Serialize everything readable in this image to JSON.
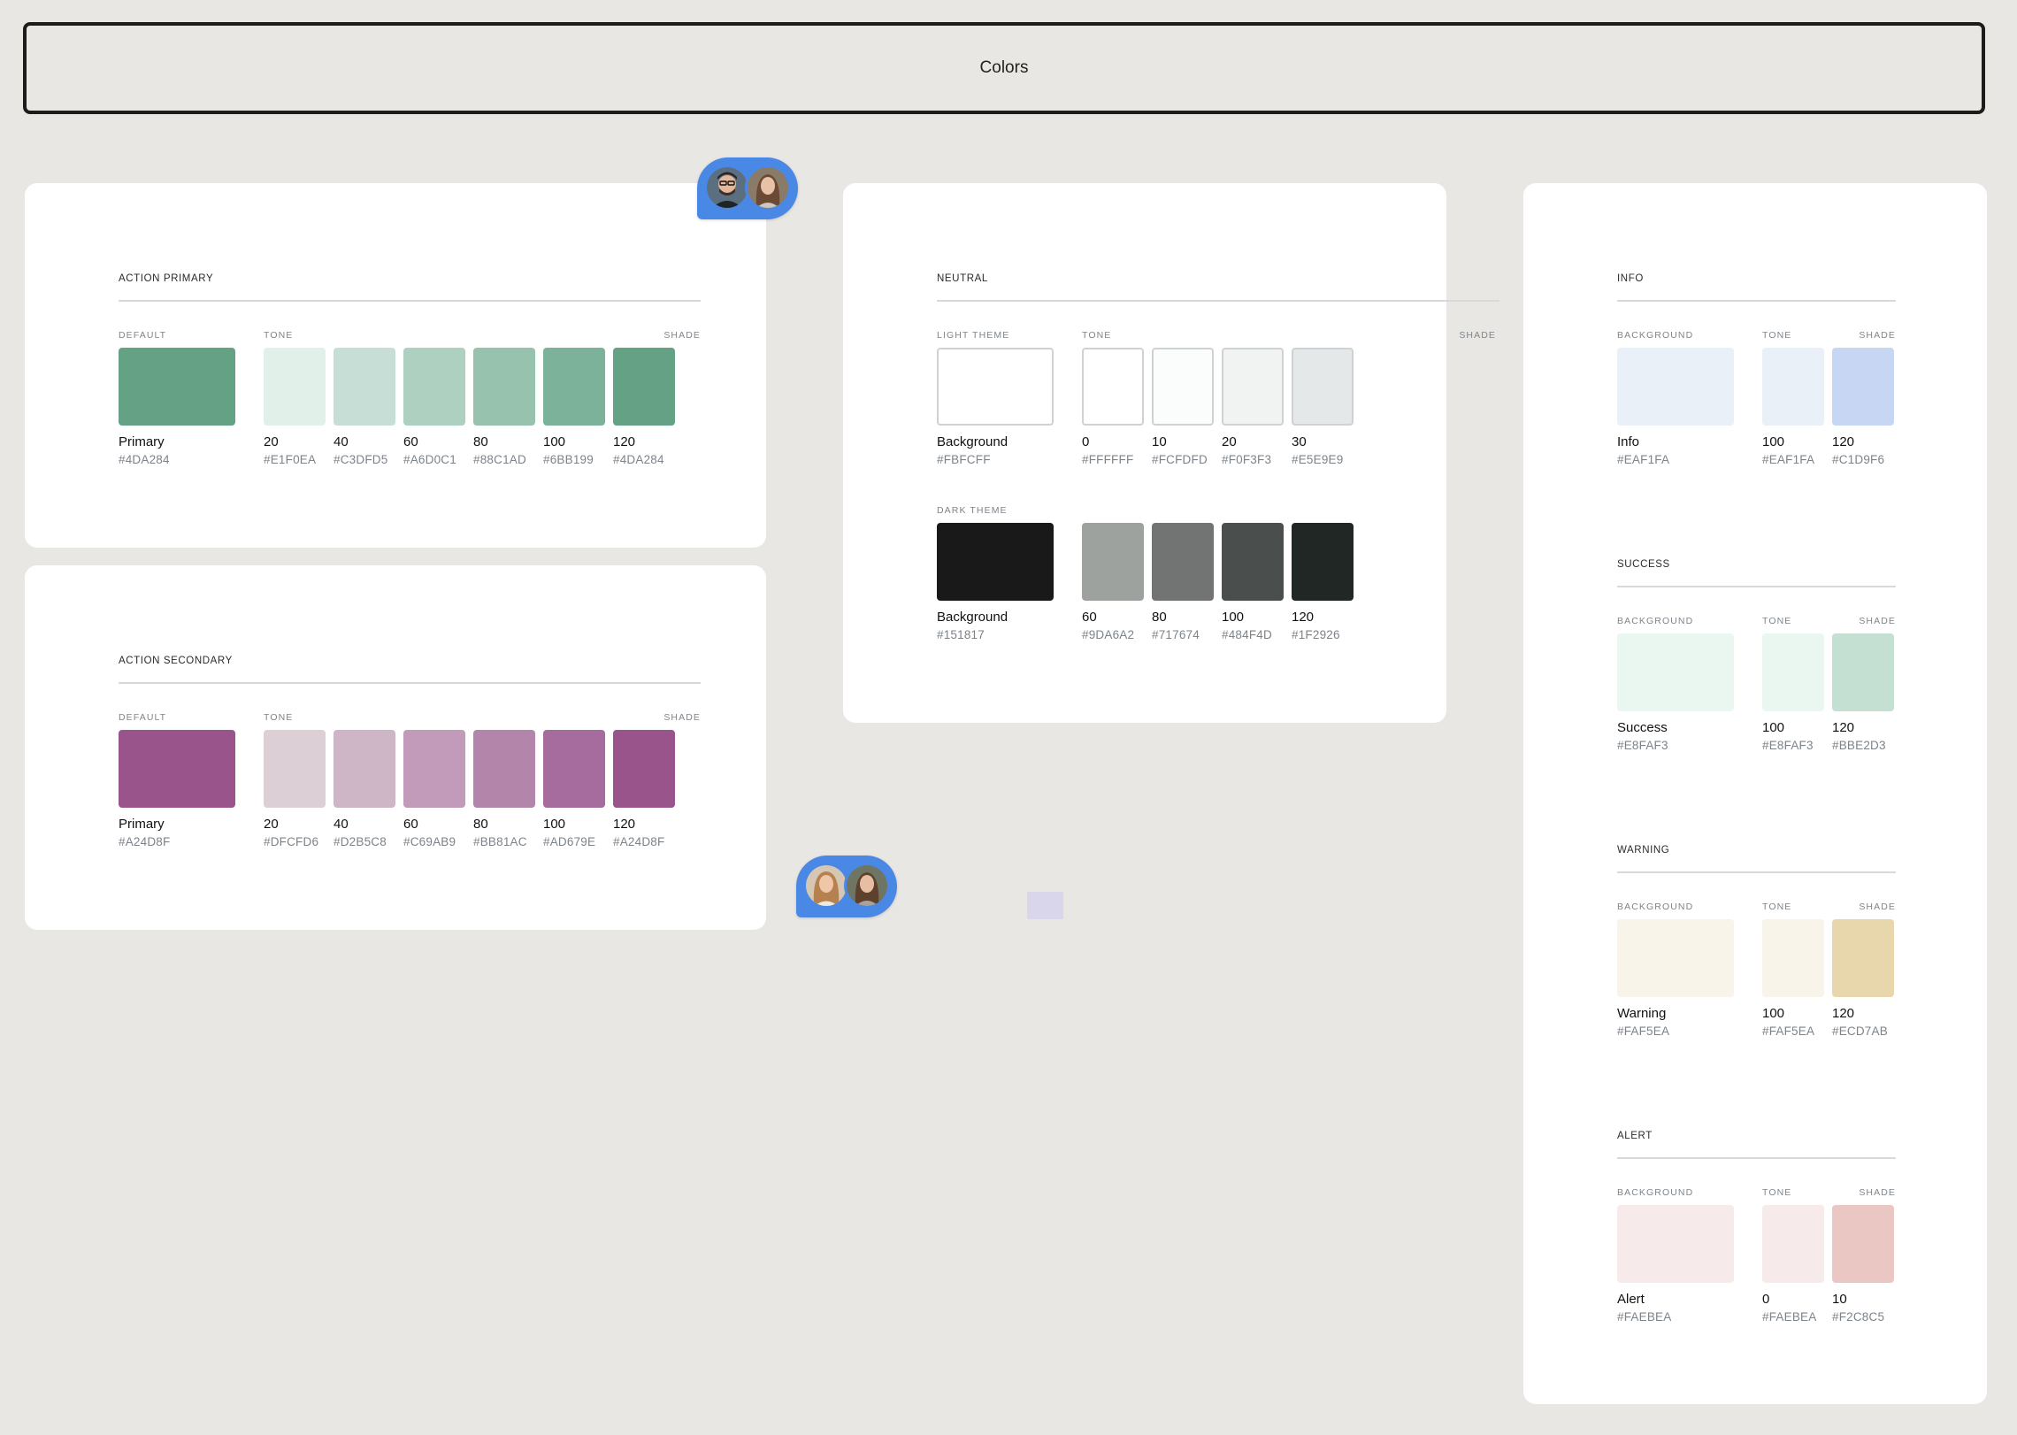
{
  "header": {
    "title": "Colors"
  },
  "action_primary": {
    "title": "ACTION PRIMARY",
    "labels": {
      "default": "DEFAULT",
      "tone": "TONE",
      "shade": "SHADE"
    },
    "default": {
      "name": "Primary",
      "hex": "#4DA284",
      "color": "#64a185"
    },
    "tones": [
      {
        "name": "20",
        "hex": "#E1F0EA",
        "color": "#e2f0ea"
      },
      {
        "name": "40",
        "hex": "#C3DFD5",
        "color": "#c6ded5"
      },
      {
        "name": "60",
        "hex": "#A6D0C1",
        "color": "#add0c1"
      },
      {
        "name": "80",
        "hex": "#88C1AD",
        "color": "#97c2ae"
      },
      {
        "name": "100",
        "hex": "#6BB199",
        "color": "#7db29a"
      },
      {
        "name": "120",
        "hex": "#4DA284",
        "color": "#64a185"
      }
    ]
  },
  "action_secondary": {
    "title": "ACTION SECONDARY",
    "labels": {
      "default": "DEFAULT",
      "tone": "TONE",
      "shade": "SHADE"
    },
    "default": {
      "name": "Primary",
      "hex": "#A24D8F",
      "color": "#98548b"
    },
    "tones": [
      {
        "name": "20",
        "hex": "#DFCFD6",
        "color": "#ddcfd6"
      },
      {
        "name": "40",
        "hex": "#D2B5C8",
        "color": "#cfb6c7"
      },
      {
        "name": "60",
        "hex": "#C69AB9",
        "color": "#c19bb9"
      },
      {
        "name": "80",
        "hex": "#BB81AC",
        "color": "#b485ab"
      },
      {
        "name": "100",
        "hex": "#AD679E",
        "color": "#a66c9d"
      },
      {
        "name": "120",
        "hex": "#A24D8F",
        "color": "#98548b"
      }
    ]
  },
  "neutral": {
    "title": "NEUTRAL",
    "light": {
      "labels": {
        "default": "LIGHT THEME",
        "tone": "TONE",
        "shade": "SHADE"
      },
      "default": {
        "name": "Background",
        "hex": "#FBFCFF",
        "color": "#ffffff"
      },
      "tones": [
        {
          "name": "0",
          "hex": "#FFFFFF",
          "color": "#ffffff"
        },
        {
          "name": "10",
          "hex": "#FCFDFD",
          "color": "#fbfcfc"
        },
        {
          "name": "20",
          "hex": "#F0F3F3",
          "color": "#f1f3f2"
        },
        {
          "name": "30",
          "hex": "#E5E9E9",
          "color": "#e5e8e8"
        }
      ]
    },
    "dark": {
      "labels": {
        "default": "DARK THEME"
      },
      "default": {
        "name": "Background",
        "hex": "#151817",
        "color": "#181918"
      },
      "tones": [
        {
          "name": "60",
          "hex": "#9DA6A2",
          "color": "#9da29f"
        },
        {
          "name": "80",
          "hex": "#717674",
          "color": "#717472"
        },
        {
          "name": "100",
          "hex": "#484F4D",
          "color": "#4a4f4d"
        },
        {
          "name": "120",
          "hex": "#1F2926",
          "color": "#202724"
        }
      ]
    }
  },
  "status": [
    {
      "key": "info",
      "title": "INFO",
      "labels": {
        "default": "BACKGROUND",
        "tone": "TONE",
        "shade": "SHADE"
      },
      "default": {
        "name": "Info",
        "hex": "#EAF1FA",
        "color": "#eaf0f8"
      },
      "tones": [
        {
          "name": "100",
          "hex": "#EAF1FA",
          "color": "#eaf0f8"
        },
        {
          "name": "120",
          "hex": "#C1D9F6",
          "color": "#c7d7f3"
        }
      ]
    },
    {
      "key": "success",
      "title": "SUCCESS",
      "labels": {
        "default": "BACKGROUND",
        "tone": "TONE",
        "shade": "SHADE"
      },
      "default": {
        "name": "Success",
        "hex": "#E8FAF3",
        "color": "#e9f7f0"
      },
      "tones": [
        {
          "name": "100",
          "hex": "#E8FAF3",
          "color": "#e9f7f0"
        },
        {
          "name": "120",
          "hex": "#BBE2D3",
          "color": "#c3e0d2"
        }
      ]
    },
    {
      "key": "warning",
      "title": "WARNING",
      "labels": {
        "default": "BACKGROUND",
        "tone": "TONE",
        "shade": "SHADE"
      },
      "default": {
        "name": "Warning",
        "hex": "#FAF5EA",
        "color": "#f8f4ea"
      },
      "tones": [
        {
          "name": "100",
          "hex": "#FAF5EA",
          "color": "#f8f4ea"
        },
        {
          "name": "120",
          "hex": "#ECD7AB",
          "color": "#e8d7ad"
        }
      ]
    },
    {
      "key": "alert",
      "title": "ALERT",
      "labels": {
        "default": "BACKGROUND",
        "tone": "TONE",
        "shade": "SHADE"
      },
      "default": {
        "name": "Alert",
        "hex": "#FAEBEA",
        "color": "#f6ebea"
      },
      "tones": [
        {
          "name": "0",
          "hex": "#FAEBEA",
          "color": "#f6ebea"
        },
        {
          "name": "10",
          "hex": "#F2C8C5",
          "color": "#ebc7c4"
        }
      ]
    }
  ],
  "collaborators": {
    "accent": "#4a88e6",
    "group_1": [
      "avatar-man-glasses",
      "avatar-woman-brown-hair"
    ],
    "group_2": [
      "avatar-woman-blonde",
      "avatar-woman-brown-hair"
    ]
  }
}
